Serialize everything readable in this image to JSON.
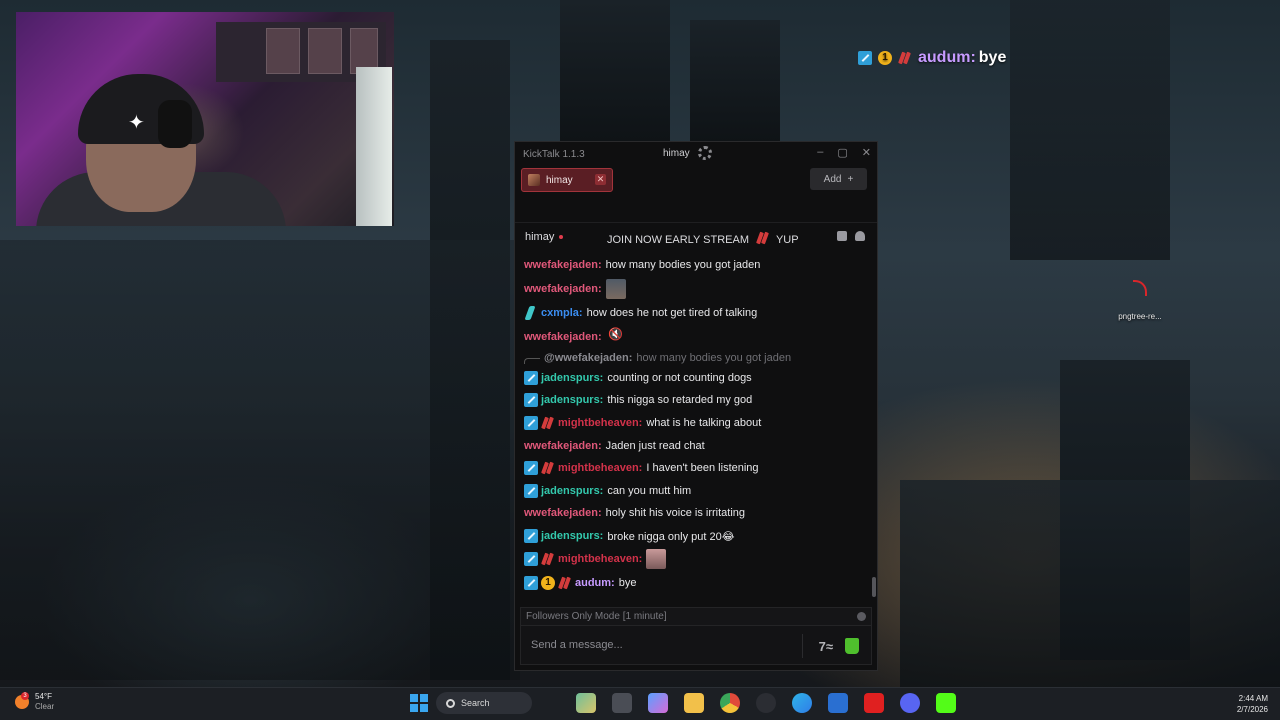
{
  "overlay": {
    "user": "audum:",
    "message": "bye",
    "gold_badge": "1"
  },
  "window": {
    "app_title": "KickTalk 1.1.3",
    "channel": "himay",
    "minimize": "–",
    "maximize": "▢",
    "close": "✕"
  },
  "tabs": [
    {
      "label": "himay",
      "close": "✕"
    }
  ],
  "add_button": {
    "label": "Add",
    "icon": "+"
  },
  "channel_header": {
    "name": "himay",
    "title_left": "JOIN NOW EARLY STREAM",
    "title_right": "YUP"
  },
  "messages": [
    {
      "user": "wwefakejaden:",
      "text": "how many bodies you got jaden"
    },
    {
      "user": "wwefakejaden:",
      "text": "",
      "emote": "face-emote"
    },
    {
      "user": "cxmpla:",
      "text": "how does he not get tired of talking"
    },
    {
      "user": "wwefakejaden:",
      "text": "",
      "emote": "mute-emote",
      "emote_glyph": "🔇"
    },
    {
      "reply_user": "@wwefakejaden:",
      "reply_text": "how many bodies you got jaden"
    },
    {
      "user": "jadenspurs:",
      "text": "counting or not counting dogs"
    },
    {
      "user": "jadenspurs:",
      "text": "this nigga so retarded my god"
    },
    {
      "user": "mightbeheaven:",
      "text": "what is he talking about"
    },
    {
      "user": "wwefakejaden:",
      "text": "Jaden just read chat"
    },
    {
      "user": "mightbeheaven:",
      "text": "I haven't been listening"
    },
    {
      "user": "jadenspurs:",
      "text": "can you mutt him"
    },
    {
      "user": "wwefakejaden:",
      "text": "holy shit his voice is irritating"
    },
    {
      "user": "jadenspurs:",
      "text": "broke nigga only put 20😂"
    },
    {
      "user": "mightbeheaven:",
      "text": "",
      "emote": "face-emote"
    },
    {
      "user": "audum:",
      "text": "bye",
      "gold_badge": "1"
    }
  ],
  "followers_mode": "Followers Only Mode [1 minute]",
  "input": {
    "placeholder": "Send a message..."
  },
  "desktop_icon": {
    "label": "pngtree-re..."
  },
  "taskbar": {
    "temperature": "54°F",
    "condition": "Clear",
    "weather_badge": "3",
    "search": "Search",
    "time": "2:44 AM",
    "date": "2/7/2026"
  },
  "colors": {
    "accent_tab": "#5a1e24",
    "user_red": "#e0587a",
    "user_blue": "#3b8df0",
    "user_teal": "#33c9ad",
    "user_crimson": "#d2324a",
    "user_purple": "#c79bff"
  }
}
